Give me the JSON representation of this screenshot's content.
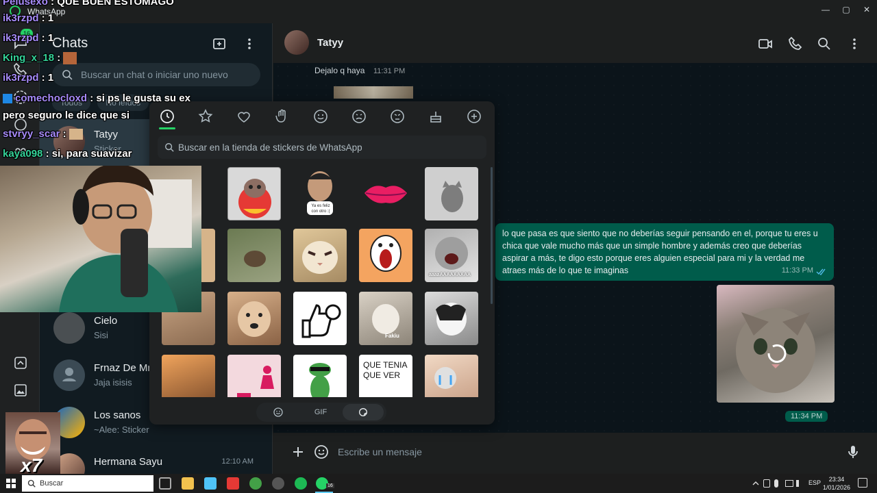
{
  "window": {
    "title": "WhatsApp",
    "controls": [
      "—",
      "▢",
      "✕"
    ]
  },
  "chatlist": {
    "title": "Chats",
    "badge": "16",
    "search_placeholder": "Buscar un chat o iniciar uno nuevo",
    "filters": [
      "Todos",
      "No leídos"
    ],
    "items": [
      {
        "name": "Tatyy",
        "preview": "Sticker",
        "time": ""
      },
      {
        "name": "Cielo",
        "preview": "Sisi",
        "time": ""
      },
      {
        "name": "Frnaz De Mro",
        "preview": "Jaja isisis",
        "time": ""
      },
      {
        "name": "Los sanos",
        "preview": "~Alee: Sticker",
        "time": ""
      },
      {
        "name": "Hermana Sayu",
        "preview": "",
        "time": "12:10 AM"
      }
    ]
  },
  "conversation": {
    "contact_name": "Tatyy",
    "top_message_fragment": "Dejalo q haya",
    "top_message_time": "11:31 PM",
    "outgoing_message": "lo que pasa es que siento que no deberías seguir pensando en el, porque tu eres u chica que vale mucho más que un simple hombre y además creo que deberías aspirar a más, te digo esto porque eres alguien especial para mi y la verdad me atraes más de lo que te imaginas",
    "outgoing_time": "11:33 PM",
    "sticker_time": "11:34 PM",
    "composer_placeholder": "Escribe un mensaje"
  },
  "sticker_panel": {
    "search_placeholder": "Buscar en la tienda de stickers de WhatsApp",
    "tabs": [
      "clock-icon",
      "star-icon",
      "heart-icon",
      "wave-icon",
      "smile-icon",
      "sad-icon",
      "angry-icon",
      "cake-icon",
      "plus-icon"
    ],
    "sticker_texts": {
      "face_caption": "Ya es feliz con otro :(",
      "scream": "aaaaAAAAAAAAA",
      "fakiu": "Fakiu",
      "quote": "QUE TENIA QUE VER"
    },
    "bottom_tabs": {
      "gif": "GIF"
    }
  },
  "overlay_chat": [
    {
      "user": "Pelusexo",
      "msg": "QUE BUEN ESTOMAGO"
    },
    {
      "user": "ik3rzpd",
      "msg": "1"
    },
    {
      "user": "ik3rzpd",
      "msg": "1"
    },
    {
      "user": "King_x_18",
      "msg": ""
    },
    {
      "user": "ik3rzpd",
      "msg": "1"
    },
    {
      "user": "comechocloxd",
      "msg": "si ps le gusta su ex"
    },
    {
      "user": "",
      "msg": "pero seguro le dice que si"
    },
    {
      "user": "stvryy_scar",
      "msg": ""
    },
    {
      "user": "kaya098",
      "msg": "si, para suavizar"
    }
  ],
  "emote_label": "x7",
  "taskbar": {
    "search_label": "Buscar",
    "whatsapp_badge": "16",
    "lang": "ESP",
    "time": "23:34",
    "date": "1/01/2026"
  },
  "colors": {
    "accent": "#25d366",
    "bubble_out": "#005c4b",
    "panel": "#1d1f1f",
    "bg": "#0b141a"
  }
}
